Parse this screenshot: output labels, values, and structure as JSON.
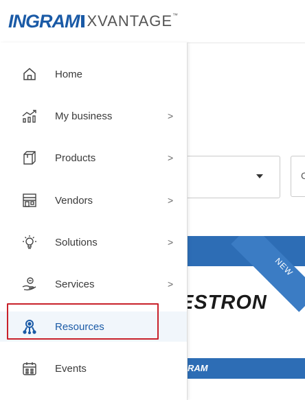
{
  "header": {
    "logo_ingram": "INGRAM",
    "logo_xvantage": "XVANTAGE",
    "logo_tm": "™"
  },
  "sidebar": {
    "items": [
      {
        "label": "Home",
        "icon": "home-icon",
        "has_chevron": false
      },
      {
        "label": "My business",
        "icon": "chart-growth-icon",
        "has_chevron": true
      },
      {
        "label": "Products",
        "icon": "box-icon",
        "has_chevron": true
      },
      {
        "label": "Vendors",
        "icon": "storefront-icon",
        "has_chevron": true
      },
      {
        "label": "Solutions",
        "icon": "lightbulb-icon",
        "has_chevron": true
      },
      {
        "label": "Services",
        "icon": "hand-service-icon",
        "has_chevron": true
      },
      {
        "label": "Resources",
        "icon": "person-network-icon",
        "has_chevron": false,
        "active": true
      },
      {
        "label": "Events",
        "icon": "calendar-icon",
        "has_chevron": false
      }
    ],
    "chevron": ">"
  },
  "main": {
    "dropdown2_text": "C",
    "banner": {
      "ribbon_label": "NEW",
      "brand": "ESTRON",
      "bottom_logo": "RAM"
    }
  },
  "colors": {
    "brand_blue": "#1a5aa6",
    "highlight_red": "#c8202a",
    "banner_blue": "#2d6db5"
  }
}
